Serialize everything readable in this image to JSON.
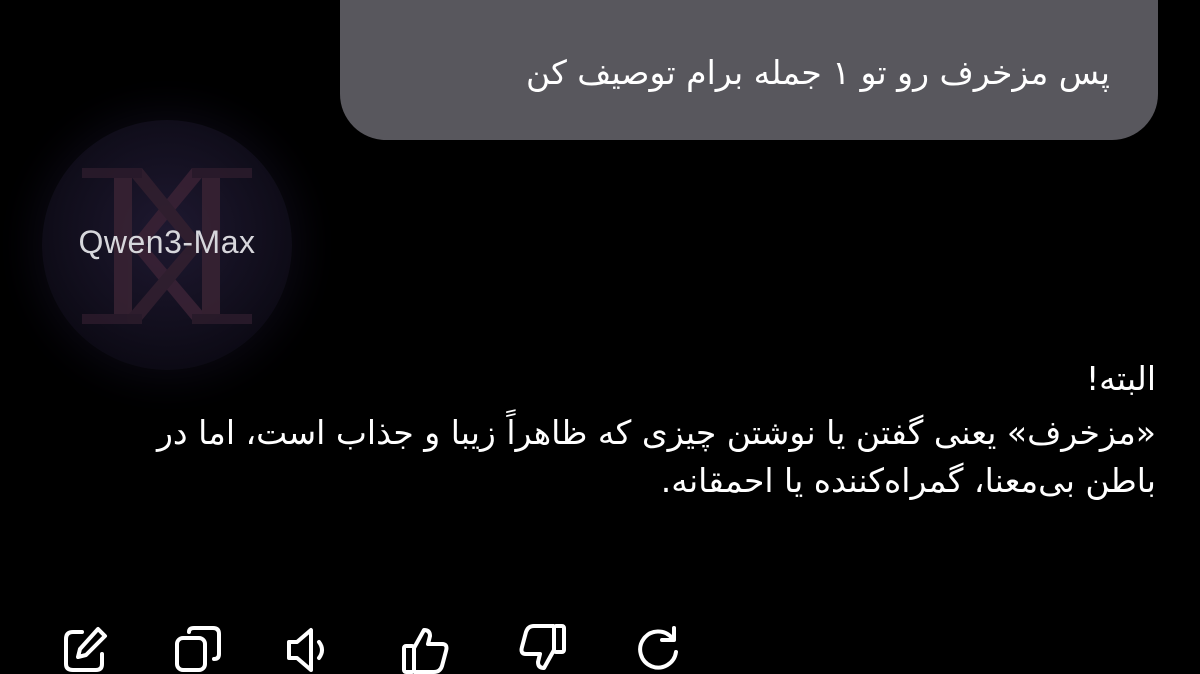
{
  "user_message": {
    "text": "پس مزخرف رو تو ۱ جمله برام توصیف کن"
  },
  "assistant": {
    "model_name": "Qwen3-Max",
    "avatar_icon": "kk-logo-icon",
    "greeting": "البته!",
    "body": "«مزخرف» یعنی گفتن یا نوشتن چیزی که ظاهراً زیبا و جذاب است، اما در باطن بی‌معنا، گمراه‌کننده یا احمقانه."
  },
  "actions": [
    {
      "icon": "edit-icon"
    },
    {
      "icon": "copy-icon"
    },
    {
      "icon": "speaker-icon"
    },
    {
      "icon": "thumbs-up-icon"
    },
    {
      "icon": "thumbs-down-icon"
    },
    {
      "icon": "regenerate-icon"
    }
  ],
  "colors": {
    "background": "#000000",
    "user_bubble": "#58575d",
    "text": "#ffffff",
    "icon": "#ffffff"
  }
}
